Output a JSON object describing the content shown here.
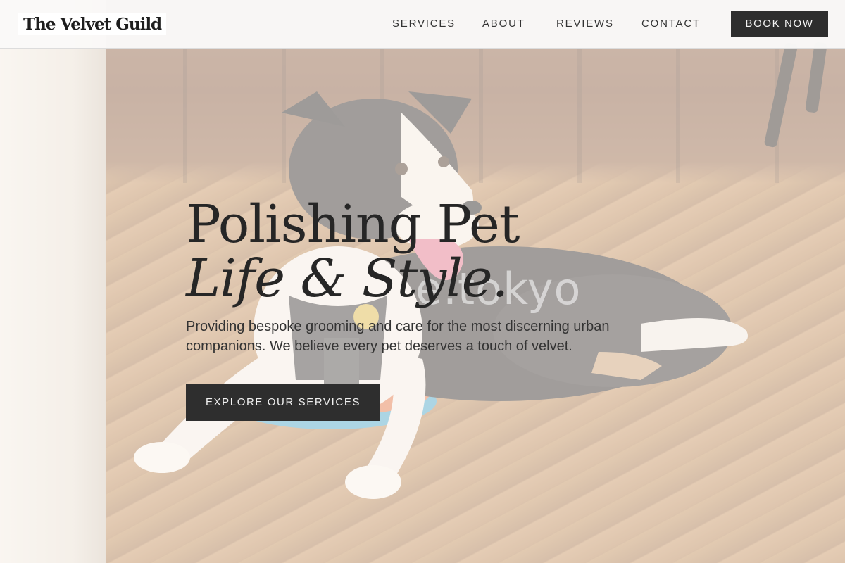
{
  "brand": {
    "name": "The Velvet Guild"
  },
  "nav": {
    "items": [
      {
        "label": "SERVICES"
      },
      {
        "label": "ABOUT"
      },
      {
        "label": "REVIEWS"
      },
      {
        "label": "CONTACT"
      }
    ],
    "cta_label": "BOOK NOW"
  },
  "hero": {
    "headline_line1": "Polishing Pet",
    "headline_line2": "Life & Style.",
    "subtitle": "Providing bespoke grooming and care for the most discerning urban companions. We believe every pet deserves a touch of velvet.",
    "cta_label": "EXPLORE OUR SERVICES",
    "watermark": "e.tokyo"
  },
  "colors": {
    "nav_background": "#faf9f8",
    "button_background": "#2e2e2e",
    "button_text": "#f1f1f1",
    "text_primary": "#262626"
  },
  "icons": [
    "logo-wordmark"
  ]
}
